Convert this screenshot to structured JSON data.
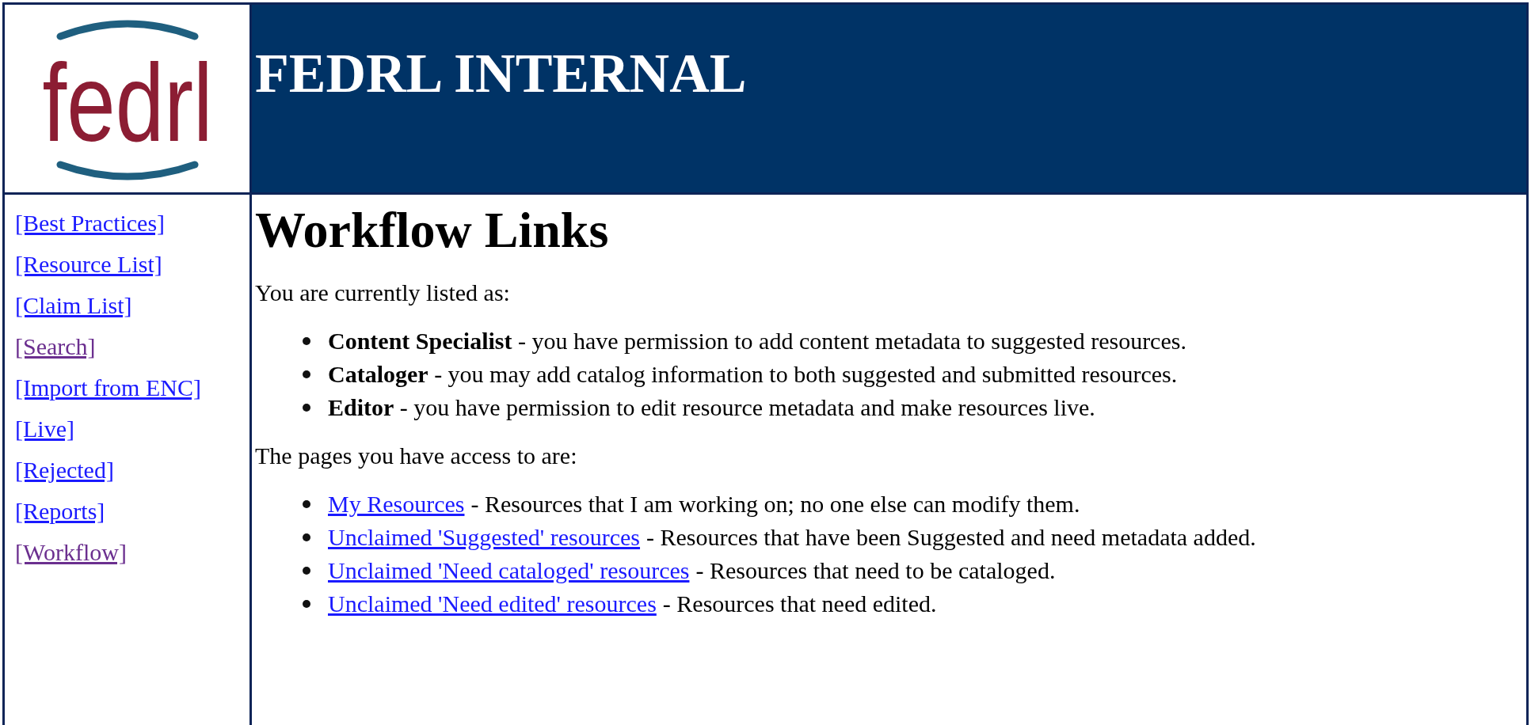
{
  "logo": {
    "text": "fedrl"
  },
  "header": {
    "title": "FEDRL INTERNAL"
  },
  "nav": [
    {
      "label": "[Best Practices]",
      "visited": false
    },
    {
      "label": "[Resource List]",
      "visited": false
    },
    {
      "label": "[Claim List]",
      "visited": false
    },
    {
      "label": "[Search]",
      "visited": true
    },
    {
      "label": "[Import from ENC]",
      "visited": false
    },
    {
      "label": "[Live]",
      "visited": false
    },
    {
      "label": "[Rejected]",
      "visited": false
    },
    {
      "label": "[Reports]",
      "visited": false
    },
    {
      "label": "[Workflow]",
      "visited": true
    }
  ],
  "heading": "Workflow Links",
  "roles_intro": "You are currently listed as:",
  "roles": [
    "**Content Specialist** - you have permission to add content metadata to suggested resources.",
    "**Cataloger** - you may add catalog information to both suggested and submitted resources.",
    "**Editor** - you have permission to edit resource metadata and make resources live."
  ],
  "pages_intro": "The pages you have access to are:",
  "pages": [
    {
      "link": "My Resources",
      "description": "- Resources that I am working on; no one else can modify them."
    },
    {
      "link": "Unclaimed 'Suggested' resources",
      "description": "- Resources that have been Suggested and need metadata added."
    },
    {
      "link": "Unclaimed 'Need cataloged' resources",
      "description": "- Resources that need to be cataloged."
    },
    {
      "link": "Unclaimed 'Need edited' resources",
      "description": "- Resources that need edited."
    }
  ]
}
